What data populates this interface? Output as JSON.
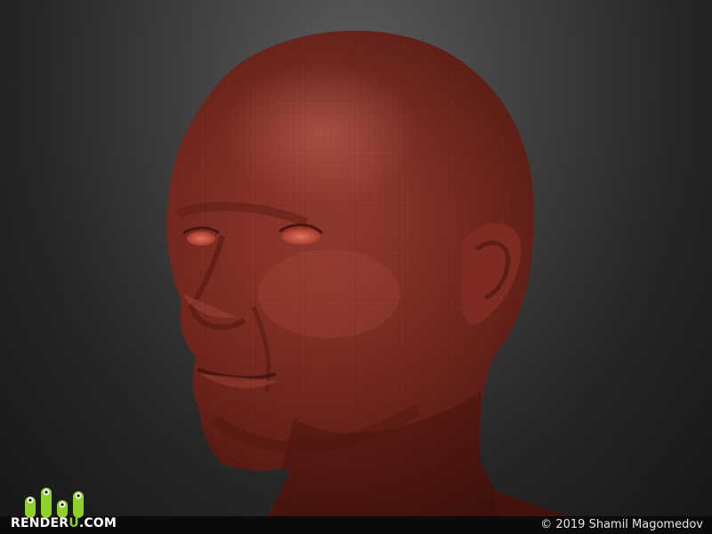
{
  "watermark": {
    "brand_prefix": "RENDER",
    "brand_accent": "U",
    "brand_suffix": ".COM",
    "accent_color": "#8fd12a"
  },
  "footer": {
    "copyright": "© 2019 Shamil Magomedov"
  },
  "image": {
    "subject_icon": "sculpted-head-render",
    "clay_color": "#8a3328"
  }
}
